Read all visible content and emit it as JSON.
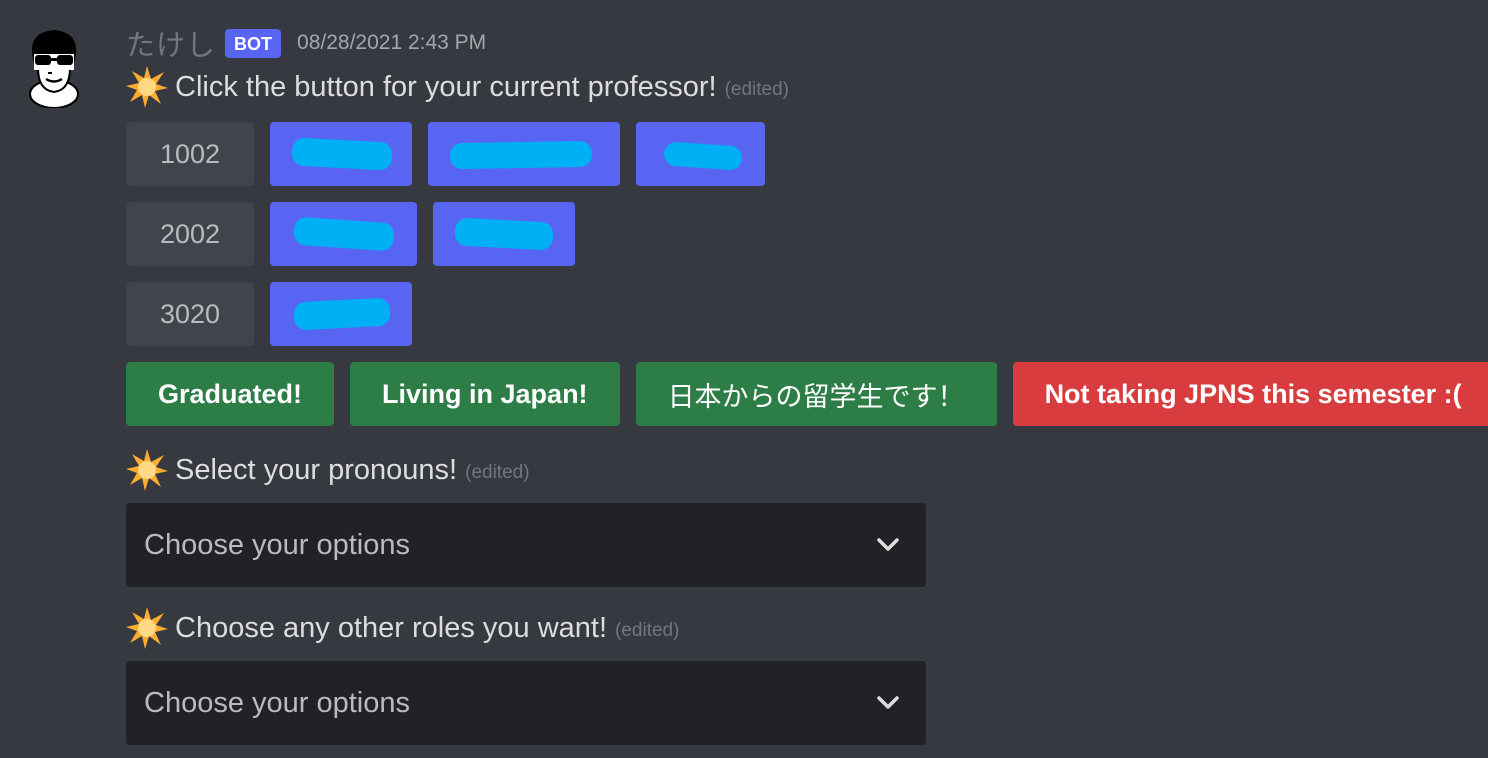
{
  "author": {
    "username": "たけし",
    "badge": "BOT",
    "timestamp": "08/28/2021 2:43 PM",
    "avatar_icon": "cartoon-face-sunglasses-avatar"
  },
  "messages": {
    "professor": {
      "emoji": "glowing-star-icon",
      "text": "Click the button for your current professor!",
      "edited": "(edited)"
    },
    "pronouns": {
      "emoji": "glowing-star-icon",
      "text": "Select your pronouns!",
      "edited": "(edited)"
    },
    "other_roles": {
      "emoji": "glowing-star-icon",
      "text": "Choose any other roles you want!",
      "edited": "(edited)"
    }
  },
  "course_rows": [
    {
      "course": "1002",
      "professor_buttons": 3
    },
    {
      "course": "2002",
      "professor_buttons": 2
    },
    {
      "course": "3020",
      "professor_buttons": 1
    }
  ],
  "status_buttons": {
    "graduated": "Graduated!",
    "living_in_japan": "Living in Japan!",
    "exchange_student": "日本からの留学生です！",
    "not_taking": "Not taking JPNS this semester :("
  },
  "selects": {
    "pronouns_placeholder": "Choose your options",
    "roles_placeholder": "Choose your options"
  },
  "colors": {
    "background": "#36393f",
    "blurple": "#5865f2",
    "green": "#2d7d46",
    "red": "#d83c3e",
    "select_bg": "#202225",
    "redaction": "#00b0f4"
  }
}
